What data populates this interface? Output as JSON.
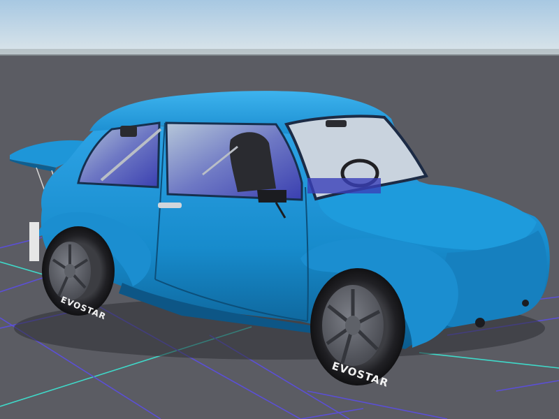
{
  "viewport": {
    "background_sky_top": "#a9c9e3",
    "background_sky_horizon": "#d9e4ea",
    "ground_color": "#5b5c63",
    "grid_major_color": "#3fd9c9",
    "grid_minor_color": "#5b4fd6"
  },
  "car": {
    "body_color": "#1a8ccf",
    "body_shadow_color": "#0e5f91",
    "glass_color": "#3a3fb0",
    "tire_brand_front": "EVOSTAR",
    "tire_brand_rear": "EVOSTAR"
  }
}
